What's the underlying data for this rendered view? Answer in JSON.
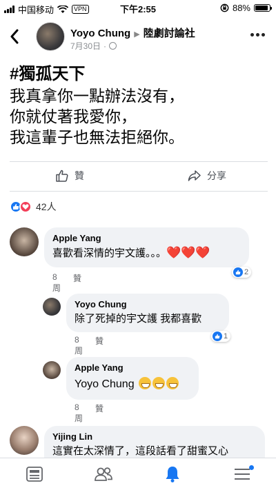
{
  "status_bar": {
    "carrier": "中国移动",
    "vpn": "VPN",
    "time": "下午2:55",
    "battery": "88%",
    "battery_level": 0.88
  },
  "post": {
    "author": "Yoyo Chung",
    "group": "陸劇討論社",
    "date": "7月30日",
    "hashtag": "#獨孤天下",
    "lines": [
      "我真拿你一點辦法沒有，",
      "你就仗著我愛你，",
      "我這輩子也無法拒絕你。"
    ]
  },
  "actions": {
    "like": "贊",
    "share": "分享"
  },
  "reactions": {
    "count": "42人"
  },
  "comments": [
    {
      "name": "Apple Yang",
      "text": "喜歡看深情的宇文護。。。",
      "hearts": "❤️❤️❤️",
      "time": "8周",
      "like": "贊",
      "react_count": "2"
    },
    {
      "name": "Yoyo Chung",
      "text": "除了死掉的宇文護 我都喜歡",
      "time": "8周",
      "like": "贊",
      "react_count": "1"
    },
    {
      "name": "Apple Yang",
      "text": "Yoyo Chung",
      "time": "8周",
      "like": "贊"
    },
    {
      "name": "Yijing Lin",
      "text": "這實在太深情了，這段話看了甜蜜又心"
    }
  ],
  "colors": {
    "accent": "#1877f2",
    "love": "#f33e58",
    "bubble": "#f0f2f5"
  },
  "icons": {
    "back": "chevron-left-icon",
    "more": "more-dots-icon",
    "nav": [
      "news-feed-icon",
      "friends-icon",
      "notifications-bell-icon",
      "menu-icon"
    ]
  }
}
